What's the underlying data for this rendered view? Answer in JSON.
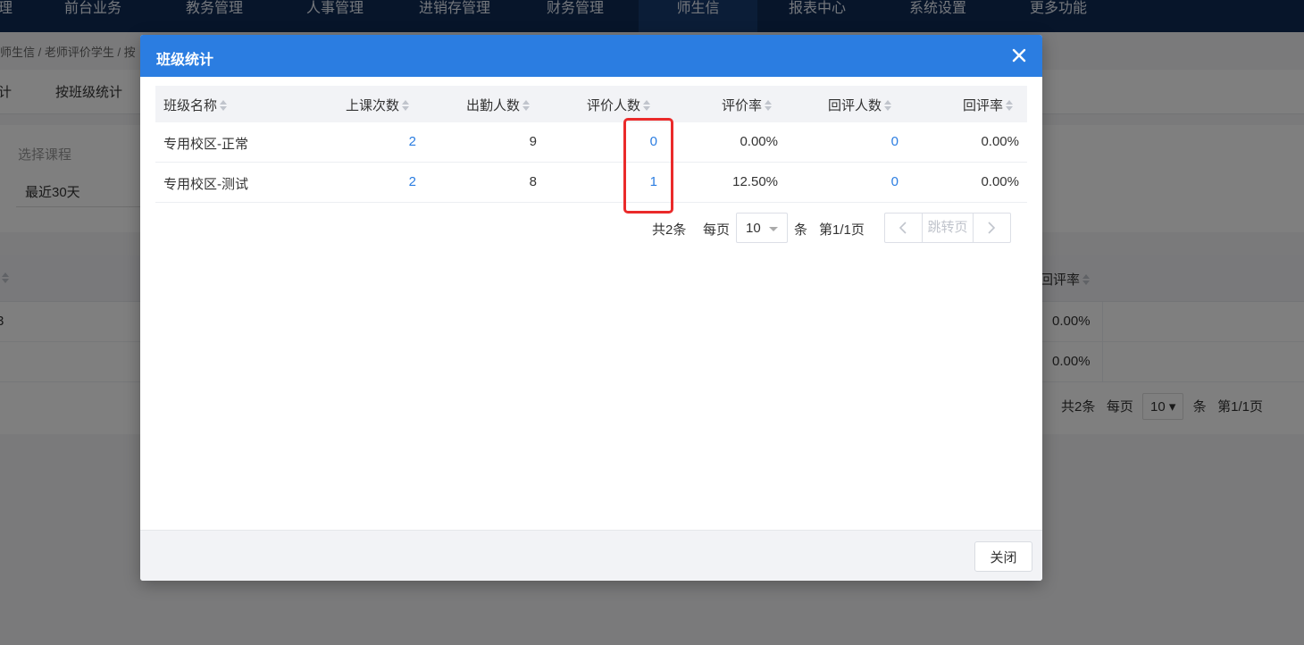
{
  "topnav": {
    "items": [
      "理",
      "前台业务",
      "教务管理",
      "人事管理",
      "进销存管理",
      "财务管理",
      "师生信",
      "报表中心",
      "系统设置",
      "更多功能"
    ],
    "active_index": 6
  },
  "breadcrumb": "师生信 / 老师评价学生 / 按",
  "subtabs": [
    "计",
    "按班级统计"
  ],
  "filter": {
    "label": "选择课程",
    "value": "最近30天"
  },
  "bg_table": {
    "visible_header": "回评率",
    "rows": [
      {
        "stub": "3",
        "rate": "0.00%"
      },
      {
        "stub": "",
        "rate": "0.00%"
      }
    ],
    "pager": {
      "total": "共2条",
      "per_page_label": "每页",
      "per_page": "10",
      "unit": "条",
      "page_info": "第1/1页"
    }
  },
  "modal": {
    "title": "班级统计",
    "columns": [
      "班级名称",
      "上课次数",
      "出勤人数",
      "评价人数",
      "评价率",
      "回评人数",
      "回评率"
    ],
    "rows": [
      {
        "class_name": "专用校区-正常",
        "lessons": "2",
        "attendance": "9",
        "evaluated": "0",
        "eval_rate": "0.00%",
        "replied": "0",
        "reply_rate": "0.00%"
      },
      {
        "class_name": "专用校区-测试",
        "lessons": "2",
        "attendance": "8",
        "evaluated": "1",
        "eval_rate": "12.50%",
        "replied": "0",
        "reply_rate": "0.00%"
      }
    ],
    "pager": {
      "total": "共2条",
      "per_page_label": "每页",
      "per_page": "10",
      "unit": "条",
      "page_info": "第1/1页",
      "jump_label": "跳转页"
    },
    "close_label": "关闭"
  },
  "colors": {
    "header_blue": "#2b7de1",
    "link_blue": "#2b7de1",
    "highlight_red": "#ea2a2a",
    "nav_dark": "#0e2a55"
  },
  "icons": {
    "close": "close-icon",
    "sort": "sort-icon",
    "prev": "chevron-left-icon",
    "next": "chevron-right-icon",
    "dropdown": "caret-down-icon"
  }
}
